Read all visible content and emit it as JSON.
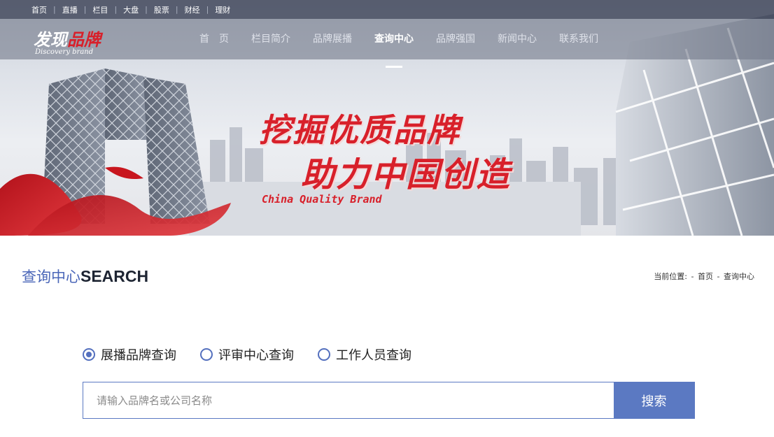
{
  "topbar": {
    "links": [
      "首页",
      "直播",
      "栏目",
      "大盘",
      "股票",
      "财经",
      "理财"
    ]
  },
  "logo": {
    "cn_white": "发现",
    "cn_red": "品牌",
    "en": "Discovery brand"
  },
  "nav": {
    "items": [
      "首　页",
      "栏目简介",
      "品牌展播",
      "查询中心",
      "品牌强国",
      "新闻中心",
      "联系我们"
    ],
    "active": "查询中心"
  },
  "banner": {
    "line1": "挖掘优质品牌",
    "line2": "助力中国创造",
    "en": "China Quality Brand"
  },
  "heading": {
    "cn": "查询中心",
    "en": "SEARCH"
  },
  "breadcrumb": {
    "prefix": "当前位置:",
    "sep1": "-",
    "home": "首页",
    "sep2": "-",
    "current": "查询中心"
  },
  "search": {
    "options": [
      {
        "label": "展播品牌查询",
        "checked": true
      },
      {
        "label": "评审中心查询",
        "checked": false
      },
      {
        "label": "工作人员查询",
        "checked": false
      }
    ],
    "placeholder": "请输入品牌名或公司名称",
    "button": "搜索"
  },
  "colors": {
    "accent": "#5b79c2",
    "brand_red": "#d8202a",
    "heading_blue": "#4a66b8"
  }
}
